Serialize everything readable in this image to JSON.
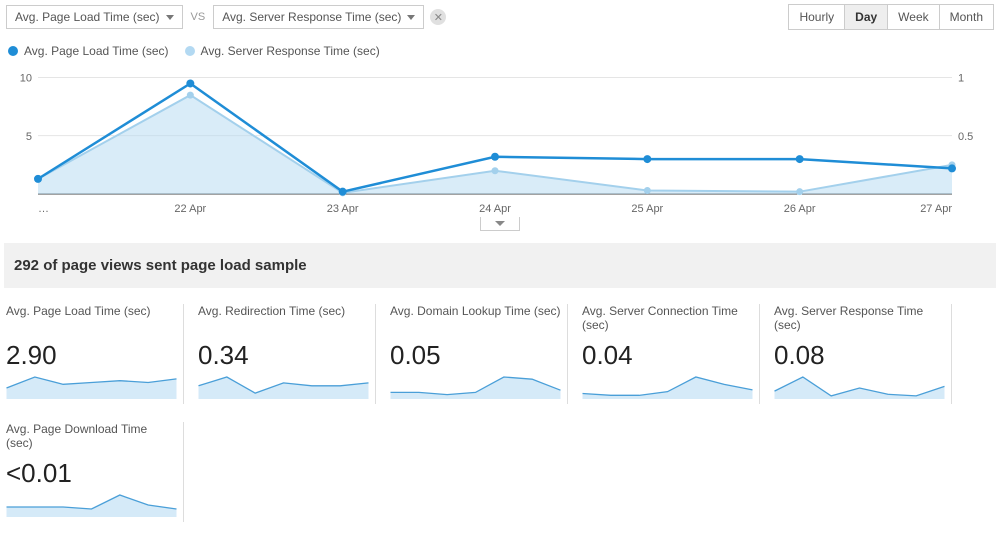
{
  "toolbar": {
    "metric1": "Avg. Page Load Time (sec)",
    "vs": "VS",
    "metric2": "Avg. Server Response Time (sec)",
    "ranges": [
      "Hourly",
      "Day",
      "Week",
      "Month"
    ],
    "active_range": "Day"
  },
  "legend": {
    "series1": "Avg. Page Load Time (sec)",
    "series2": "Avg. Server Response Time (sec)"
  },
  "chart_data": {
    "type": "line",
    "categories": [
      "…",
      "22 Apr",
      "23 Apr",
      "24 Apr",
      "25 Apr",
      "26 Apr",
      "27 Apr"
    ],
    "series": [
      {
        "name": "Avg. Page Load Time (sec)",
        "color": "#1f8dd6",
        "values": [
          1.3,
          9.5,
          0.2,
          3.2,
          3.0,
          3.0,
          2.2
        ],
        "axis": "left",
        "ylim": [
          0,
          11
        ],
        "ticks": [
          5,
          10
        ]
      },
      {
        "name": "Avg. Server Response Time (sec)",
        "color": "#a3d0ec",
        "values": [
          0.13,
          0.85,
          0.01,
          0.2,
          0.03,
          0.02,
          0.25
        ],
        "axis": "right",
        "ylim": [
          0,
          1.1
        ],
        "ticks": [
          0.5,
          1
        ]
      }
    ]
  },
  "summary": "292 of page views sent page load sample",
  "metrics": [
    {
      "label": "Avg. Page Load Time (sec)",
      "value": "2.90",
      "spark": [
        6,
        12,
        8,
        9,
        10,
        9,
        11
      ]
    },
    {
      "label": "Avg. Redirection Time (sec)",
      "value": "0.34",
      "spark": [
        9,
        15,
        4,
        11,
        9,
        9,
        11
      ]
    },
    {
      "label": "Avg. Domain Lookup Time (sec)",
      "value": "0.05",
      "spark": [
        3,
        3,
        2,
        3,
        10,
        9,
        4
      ]
    },
    {
      "label": "Avg. Server Connection Time (sec)",
      "value": "0.04",
      "spark": [
        3,
        2,
        2,
        4,
        12,
        8,
        5
      ]
    },
    {
      "label": "Avg. Server Response Time (sec)",
      "value": "0.08",
      "spark": [
        5,
        14,
        2,
        7,
        3,
        2,
        8
      ]
    },
    {
      "label": "Avg. Page Download Time (sec)",
      "value": "<0.01",
      "spark": [
        5,
        5,
        5,
        4,
        11,
        6,
        4
      ]
    }
  ]
}
